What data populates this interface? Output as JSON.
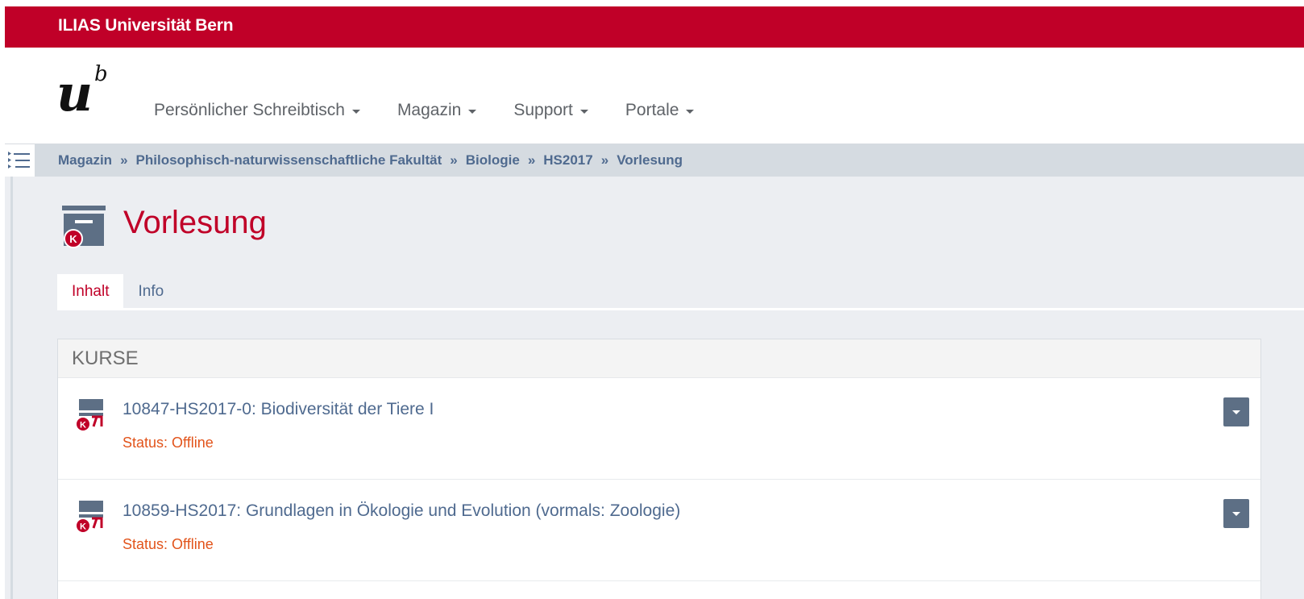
{
  "topbar": {
    "title": "ILIAS Universität Bern"
  },
  "logo": {
    "letter": "u",
    "superscript": "b"
  },
  "nav": [
    {
      "label": "Persönlicher Schreibtisch"
    },
    {
      "label": "Magazin"
    },
    {
      "label": "Support"
    },
    {
      "label": "Portale"
    }
  ],
  "breadcrumb": {
    "items": [
      "Magazin",
      "Philosophisch-naturwissenschaftliche Fakultät",
      "Biologie",
      "HS2017",
      "Vorlesung"
    ],
    "separator": "»"
  },
  "page": {
    "title": "Vorlesung",
    "icon": "category-icon"
  },
  "tabs": [
    {
      "label": "Inhalt",
      "active": true
    },
    {
      "label": "Info",
      "active": false
    }
  ],
  "panel": {
    "header": "KURSE",
    "items": [
      {
        "title": "10847-HS2017-0: Biodiversität der Tiere I",
        "status": "Status: Offline",
        "icon": "course-icon"
      },
      {
        "title": "10859-HS2017: Grundlagen in Ökologie und Evolution (vormals: Zoologie)",
        "status": "Status: Offline",
        "icon": "course-icon"
      }
    ]
  },
  "colors": {
    "brand_red": "#c00028",
    "link_blue": "#4f6a8f",
    "status_orange": "#e2541b",
    "dropdown_bg": "#5d6f85"
  }
}
